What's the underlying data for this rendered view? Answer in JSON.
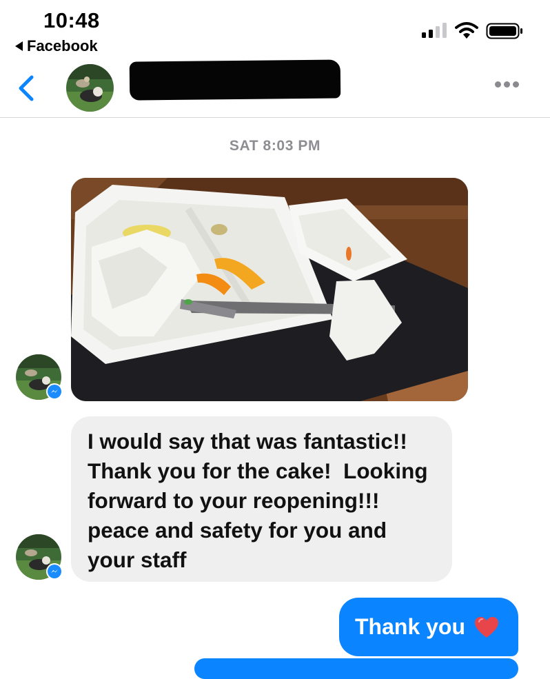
{
  "status_bar": {
    "time": "10:48",
    "back_app_label": "Facebook"
  },
  "header": {
    "contact_name_redacted": true
  },
  "thread": {
    "timestamp": "SAT 8:03 PM",
    "incoming_message": "I would say that was fantastic!! Thank you for the cake!  Looking forward to your reopening!!! peace and safety for you and your staff",
    "incoming_lines": [
      "I would say that was fantastic!!",
      "Thank you for the cake!  Looking",
      "forward to your reopening!!!",
      "peace and safety for you and",
      "your staff"
    ],
    "outgoing_message": "Thank you"
  },
  "icons": {
    "back": "chevron-left-icon",
    "more": "more-dots-icon",
    "messenger": "messenger-badge-icon",
    "heart": "heart-icon"
  },
  "colors": {
    "accent": "#0a84ff",
    "incoming_bubble": "#efefef",
    "heart": "#e8454a",
    "timestamp": "#8d8d92"
  }
}
